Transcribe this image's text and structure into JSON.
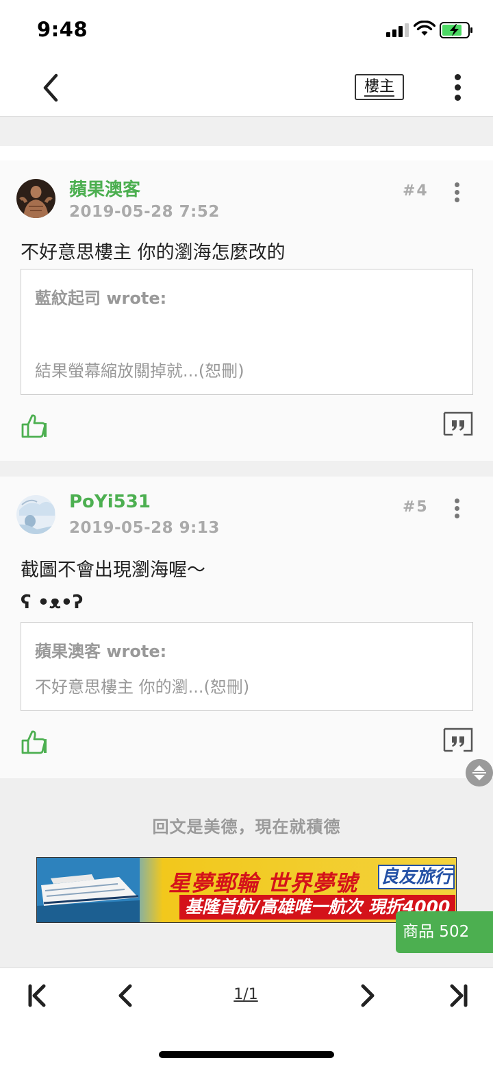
{
  "status_bar": {
    "time": "9:48"
  },
  "header": {
    "op_label": "樓主"
  },
  "posts": [
    {
      "author": "蘋果澳客",
      "date": "2019-05-28 7:52",
      "floor": "#4",
      "content": "不好意思樓主 你的瀏海怎麼改的",
      "quote": {
        "header": "藍紋起司 wrote:",
        "body": "結果螢幕縮放關掉就...(恕刪)"
      }
    },
    {
      "author": "PoYi531",
      "date": "2019-05-28 9:13",
      "floor": "#5",
      "content": "截圖不會出現瀏海喔～",
      "content2": "ʕ •ᴥ•ʔ",
      "quote": {
        "header": "蘋果澳客 wrote:",
        "body": "不好意思樓主 你的瀏...(恕刪)"
      }
    }
  ],
  "reply_hint": "回文是美德，現在就積德",
  "ad": {
    "line1": "星夢郵輪 世界夢號",
    "brand": "良友旅行",
    "line2": "基隆首航/高雄唯一航次 現折4000"
  },
  "product_button": "商品 502",
  "pagination": {
    "current": "1/1"
  },
  "colors": {
    "accent": "#4caf50",
    "meta": "#aaaaaa",
    "gap": "#f0f0f0"
  }
}
